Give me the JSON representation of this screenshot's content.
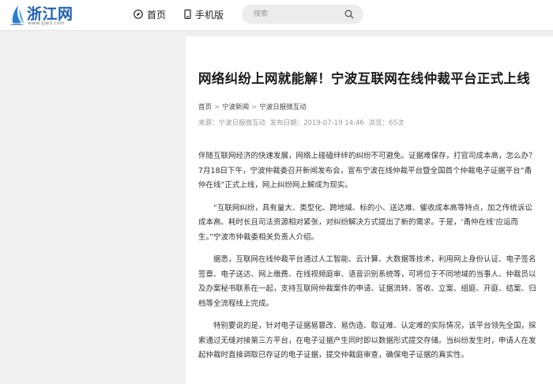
{
  "header": {
    "logo_text": "浙江网",
    "logo_url": "www.zjw3.com",
    "nav": [
      {
        "label": "首页",
        "icon": "compass-icon"
      },
      {
        "label": "手机版",
        "icon": "mobile-phone-icon"
      }
    ],
    "search": {
      "placeholder": "搜索",
      "icon": "search-icon"
    }
  },
  "article": {
    "title": "网络纠纷上网就能解！宁波互联网在线仲裁平台正式上线",
    "breadcrumb": [
      "首页",
      "宁波新闻",
      "宁波日报微互动"
    ],
    "breadcrumb_separator": ">",
    "meta": {
      "source": "来源：宁波日报微互动",
      "date": "发布日期：2019-07-19 14:46",
      "views": "浏览：65次"
    },
    "paragraphs": [
      "伴随互联网经济的快速发展，网络上碰磕绊绊的纠纷不可避免。证据难保存，打官司成本高，怎么办？7月18日下午，宁波仲裁委召开新闻发布会，宣布宁波在线仲裁平台暨全国首个仲裁电子证据平台“甬仲在线”正式上线，网上纠纷网上解成为现实。",
      "“互联网纠纷，具有量大、类型化、跨地域、标的小、送达难、催收成本高等特点，加之传统诉讼成本高、耗时长且司法资源相对紧张，对纠纷解决方式提出了新的需求。于是，‘甬仲在线’应运而生。”宁波市仲裁委相关负责人介绍。",
      "据悉，互联网在线仲裁平台通过人工智能、云计算、大数据等技术，利用网上身份认证、电子签名签章、电子送达、网上缴费、在线视频庭审、语音识别系统等，可将位于不同地域的当事人、仲裁员以及办案秘书联系在一起，支持互联网仲裁案件的申请、证据流转、答收、立案、组庭、开庭、结案、归档等全流程线上完成。",
      "特别要说的是，针对电子证据易篡改、易伪造、取证难、认定难的实际情况，该平台领先全国，探索通过无缝对接第三方平台，在电子证据产生同时即以数据形式提交存储。当纠纷发生时，申请人在发起仲裁时直接调取已存证的电子证据，提交仲裁庭审查，确保电子证据的真实性。"
    ]
  },
  "colors": {
    "logo_blue": "#1d5fb3",
    "page_bg": "#f0f0f0",
    "title_text": "#1a1a1a",
    "meta_text": "#999999"
  }
}
